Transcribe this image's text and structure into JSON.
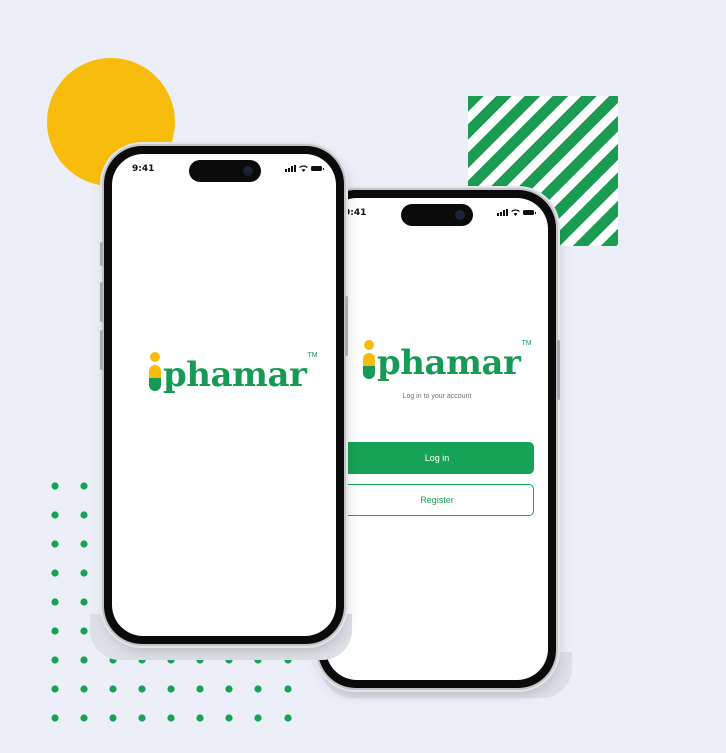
{
  "colors": {
    "background": "#eceff8",
    "brand_green": "#179a55",
    "brand_yellow": "#f8bd0c"
  },
  "splash_phone": {
    "status_time": "9:41",
    "brand": "phamar",
    "trademark": "TM"
  },
  "login_phone": {
    "status_time": "9:41",
    "brand": "phamar",
    "trademark": "TM",
    "subtitle": "Log in to your account",
    "login_label": "Log in",
    "register_label": "Register"
  },
  "icons": [
    "signal-icon",
    "wifi-icon",
    "battery-icon",
    "pill-logo-icon"
  ]
}
